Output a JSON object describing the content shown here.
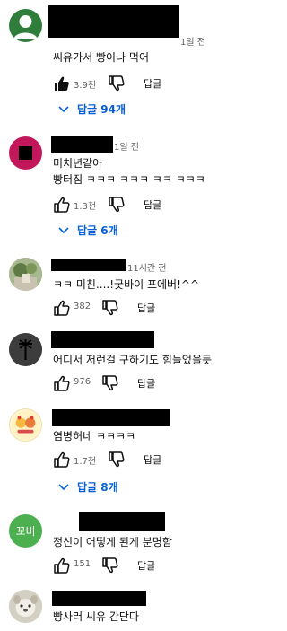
{
  "comments": [
    {
      "time": "1일 전",
      "lines": [
        "씨유가서 빵이나 먹어"
      ],
      "likes": "3.9천",
      "reply_label": "답글",
      "replies_label": "답글 94개",
      "liked": true,
      "avatar_icon": "person-icon"
    },
    {
      "time": "1일 전",
      "lines": [
        "미치년같아",
        "빵터짐 ㅋㅋㅋ ㅋㅋㅋ ㅋㅋ ㅋㅋㅋ"
      ],
      "likes": "1.3천",
      "reply_label": "답글",
      "replies_label": "답글 6개",
      "avatar_icon": "square-icon"
    },
    {
      "time": "11시간 전",
      "lines": [
        "ㅋㅋ 미친....!굿바이 포에버!^^"
      ],
      "likes": "382",
      "reply_label": "답글",
      "avatar_icon": "photo-icon"
    },
    {
      "time": "",
      "lines": [
        "어디서 저런걸 구하기도 힘들었을듯"
      ],
      "likes": "976",
      "reply_label": "답글",
      "avatar_icon": "symbol-icon"
    },
    {
      "time": "",
      "lines": [
        "염병허네 ㅋㅋㅋㅋ"
      ],
      "likes": "1.7천",
      "reply_label": "답글",
      "replies_label": "답글 8개",
      "avatar_icon": "sticker-icon"
    },
    {
      "time": "",
      "lines": [
        "정신이 어떻게 된게 분명함"
      ],
      "likes": "151",
      "reply_label": "답글",
      "avatar_text": "꼬비",
      "avatar_icon": "text-avatar"
    },
    {
      "time": "",
      "lines": [
        "빵사러 씨유 간단다"
      ],
      "avatar_icon": "photo-icon"
    }
  ],
  "colors": {
    "link_blue": "#065fd4",
    "meta_gray": "#606060",
    "avatar_green": "#2f7d3b",
    "avatar_magenta": "#c2185b",
    "avatar_kobi": "#4caf50"
  }
}
